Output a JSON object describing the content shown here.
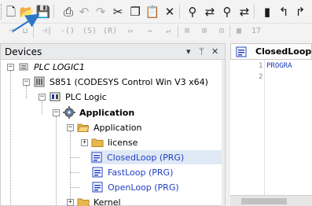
{
  "toolbar": {
    "row1": [
      {
        "name": "new-file-button",
        "icon": "new-file-icon",
        "glyph": "🗋",
        "enabled": true
      },
      {
        "name": "open-project-button",
        "icon": "folder-open-icon",
        "glyph": "📂",
        "enabled": true
      },
      {
        "name": "save-project-button",
        "icon": "save-icon",
        "glyph": "💾",
        "enabled": true
      },
      {
        "name": "print-button",
        "icon": "printer-icon",
        "glyph": "⎙",
        "enabled": true
      },
      {
        "name": "undo-button",
        "icon": "undo-icon",
        "glyph": "↶",
        "enabled": false
      },
      {
        "name": "redo-button",
        "icon": "redo-icon",
        "glyph": "↷",
        "enabled": false
      },
      {
        "name": "cut-button",
        "icon": "scissors-icon",
        "glyph": "✂",
        "enabled": true
      },
      {
        "name": "copy-button",
        "icon": "copy-icon",
        "glyph": "❐",
        "enabled": true
      },
      {
        "name": "paste-button",
        "icon": "paste-icon",
        "glyph": "📋",
        "enabled": true
      },
      {
        "name": "delete-button",
        "icon": "delete-x-icon",
        "glyph": "✕",
        "enabled": true
      },
      {
        "name": "find-button",
        "icon": "binoculars-icon",
        "glyph": "⚲",
        "enabled": true
      },
      {
        "name": "replace-button",
        "icon": "replace-icon",
        "glyph": "⇄",
        "enabled": true
      },
      {
        "name": "find-in-project-button",
        "icon": "binoculars-double-icon",
        "glyph": "⚲",
        "enabled": true
      },
      {
        "name": "replace-in-project-button",
        "icon": "replace-icon",
        "glyph": "⇄",
        "enabled": true
      },
      {
        "name": "bookmark-button",
        "icon": "bookmark-icon",
        "glyph": "▮",
        "enabled": true
      },
      {
        "name": "prev-bookmark-button",
        "icon": "bookmark-prev-icon",
        "glyph": "↰",
        "enabled": true
      },
      {
        "name": "next-bookmark-button",
        "icon": "bookmark-next-icon",
        "glyph": "↱",
        "enabled": true
      }
    ],
    "row2": [
      {
        "name": "insert-contact-button",
        "icon": "ladder-contact-icon",
        "glyph": "⊣",
        "enabled": false
      },
      {
        "name": "insert-parallel-button",
        "icon": "ladder-parallel-icon",
        "glyph": "⊔",
        "enabled": false
      },
      {
        "name": "insert-negated-contact-button",
        "icon": "ladder-neg-contact-icon",
        "glyph": "⊣|",
        "enabled": false
      },
      {
        "name": "insert-coil-button",
        "icon": "ladder-coil-icon",
        "glyph": "-()",
        "enabled": false
      },
      {
        "name": "insert-set-coil-button",
        "icon": "ladder-set-coil-icon",
        "glyph": "(S)",
        "enabled": false
      },
      {
        "name": "insert-reset-coil-button",
        "icon": "ladder-reset-coil-icon",
        "glyph": "(R)",
        "enabled": false
      },
      {
        "name": "insert-box-button",
        "icon": "ladder-box-icon",
        "glyph": "▭",
        "enabled": false
      },
      {
        "name": "insert-jump-button",
        "icon": "ladder-jump-icon",
        "glyph": "→",
        "enabled": false
      },
      {
        "name": "insert-return-button",
        "icon": "ladder-return-icon",
        "glyph": "↵",
        "enabled": false
      },
      {
        "name": "insert-network-button",
        "icon": "network-icon",
        "glyph": "⊞",
        "enabled": false
      },
      {
        "name": "insert-network-below-button",
        "icon": "network-below-icon",
        "glyph": "⊞",
        "enabled": false
      },
      {
        "name": "step-button",
        "icon": "step-icon",
        "glyph": "⊡",
        "enabled": false
      },
      {
        "name": "grid-button",
        "icon": "grid-icon",
        "glyph": "▦",
        "enabled": false
      },
      {
        "name": "view-17-button",
        "icon": "calendar-17-icon",
        "glyph": "17",
        "enabled": false
      }
    ]
  },
  "devices_panel": {
    "title": "Devices",
    "dropdown_glyph": "▾",
    "pin_glyph": "ᛘ",
    "close_glyph": "✕"
  },
  "tree": [
    {
      "name": "tree-item-project",
      "label": "PLC LOGIC1",
      "expander": "−",
      "icon": "project-icon",
      "italic": true,
      "bold": false
    },
    {
      "name": "tree-item-device",
      "label": "S851 (CODESYS Control Win V3 x64)",
      "expander": "−",
      "icon": "plc-device-icon",
      "italic": false,
      "bold": false
    },
    {
      "name": "tree-item-plc-logic",
      "label": "PLC Logic",
      "expander": "−",
      "icon": "plc-logic-icon",
      "italic": false,
      "bold": false
    },
    {
      "name": "tree-item-application",
      "label": "Application",
      "expander": "−",
      "icon": "application-gear-icon",
      "italic": false,
      "bold": true
    },
    {
      "name": "tree-item-application-folder",
      "label": "Application",
      "expander": "−",
      "icon": "folder-open-icon",
      "italic": false,
      "bold": false
    },
    {
      "name": "tree-item-license",
      "label": "license",
      "expander": "+",
      "icon": "folder-icon",
      "italic": false,
      "bold": false
    },
    {
      "name": "tree-item-closedloop",
      "label": "ClosedLoop (PRG)",
      "expander": "",
      "icon": "program-icon",
      "italic": false,
      "bold": false,
      "selected": true
    },
    {
      "name": "tree-item-fastloop",
      "label": "FastLoop (PRG)",
      "expander": "",
      "icon": "program-icon",
      "italic": false,
      "bold": false
    },
    {
      "name": "tree-item-openloop",
      "label": "OpenLoop (PRG)",
      "expander": "",
      "icon": "program-icon",
      "italic": false,
      "bold": false
    },
    {
      "name": "tree-item-kernel",
      "label": "Kernel",
      "expander": "+",
      "icon": "folder-icon",
      "italic": false,
      "bold": false
    }
  ],
  "editor": {
    "tab_label": "ClosedLoop",
    "tab_icon": "program-icon",
    "line_numbers": [
      "1",
      "2"
    ],
    "code_line_1": "PROGRA"
  },
  "annotation": {
    "arrow_color": "#2b78c7",
    "target": "save-project-button"
  },
  "colors": {
    "selection": "#dfe9f6",
    "program_text": "#1f3fc0",
    "folder": "#e8b84a"
  }
}
